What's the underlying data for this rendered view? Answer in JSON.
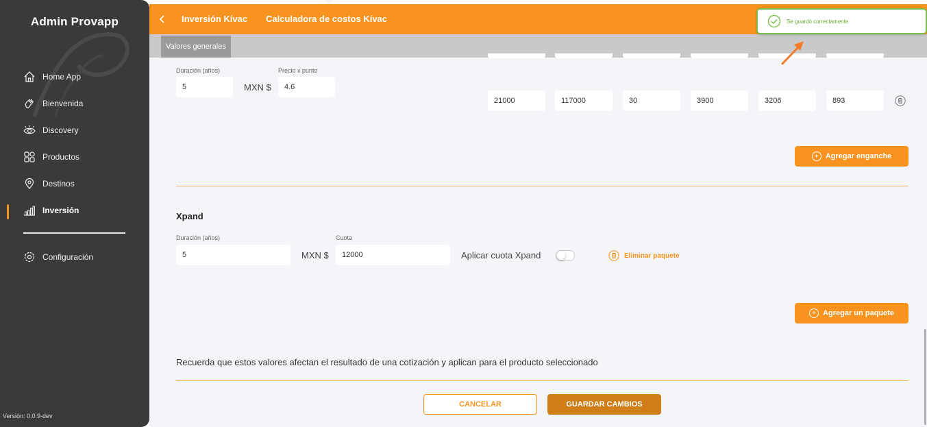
{
  "sidebar": {
    "brand": "Admin Provapp",
    "items": [
      {
        "label": "Home App",
        "icon": "home-icon"
      },
      {
        "label": "Bienvenida",
        "icon": "wave-hand-icon"
      },
      {
        "label": "Discovery",
        "icon": "eye-icon"
      },
      {
        "label": "Productos",
        "icon": "grid-icon"
      },
      {
        "label": "Destinos",
        "icon": "location-pin-icon"
      },
      {
        "label": "Inversión",
        "icon": "bar-chart-icon",
        "active": true
      },
      {
        "label": "Configuración",
        "icon": "settings-icon"
      }
    ],
    "version": "Versión: 0.0.9-dev"
  },
  "header": {
    "crumb1": "Inversión Kívac",
    "crumb2": "Calculadora de costos Kívac",
    "tab": "Valores generales"
  },
  "toast": {
    "message": "Se guardó correctamente",
    "color": "#7cbf4b"
  },
  "package1": {
    "duration_label": "Duración (años)",
    "duration_value": "5",
    "currency": "MXN $",
    "price_label": "Precio x punto",
    "price_value": "4.6",
    "row_values": [
      "21000",
      "117000",
      "30",
      "3900",
      "3206",
      "893"
    ],
    "add_button": "Agregar enganche"
  },
  "package2": {
    "title": "Xpand",
    "duration_label": "Duración (años)",
    "duration_value": "5",
    "currency": "MXN $",
    "fee_label": "Cuota",
    "fee_value": "12000",
    "toggle_label": "Aplicar cuota Xpand",
    "toggle_on": false,
    "delete_label": "Eliminar paquete"
  },
  "add_package_button": "Agregar un paquete",
  "note": "Recuerda que estos valores afectan el resultado de una cotización y aplican para el producto seleccionado",
  "footer": {
    "cancel": "CANCELAR",
    "save": "GUARDAR CAMBIOS"
  },
  "colors": {
    "accent": "#f7931e",
    "sidebar": "#3a3a3a",
    "success": "#7cbf4b"
  }
}
